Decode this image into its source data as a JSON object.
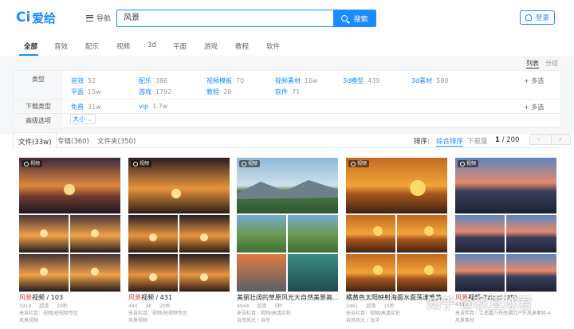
{
  "header": {
    "logo_text": "爱给",
    "nav_label": "导航",
    "search_value": "风景",
    "search_button": "搜索",
    "login_label": "登录"
  },
  "category_tabs": [
    "全部",
    "音效",
    "配乐",
    "视频",
    "3d",
    "平面",
    "游戏",
    "教程",
    "软件"
  ],
  "view_toggle": {
    "list": "列表",
    "group": "分组"
  },
  "filters": {
    "type_label": "类型",
    "type_items": [
      {
        "label": "音效",
        "count": "52"
      },
      {
        "label": "配乐",
        "count": "386"
      },
      {
        "label": "视频模板",
        "count": "70"
      },
      {
        "label": "视频素材",
        "count": "16w"
      },
      {
        "label": "3d模型",
        "count": "439"
      },
      {
        "label": "3d素材",
        "count": "580"
      },
      {
        "label": "平面",
        "count": "15w"
      },
      {
        "label": "游戏",
        "count": "1792"
      },
      {
        "label": "教程",
        "count": "28"
      },
      {
        "label": "软件",
        "count": "71"
      }
    ],
    "more_label": "+ 多选",
    "download_label": "下载类型",
    "download_items": [
      {
        "label": "免费",
        "count": "31w"
      },
      {
        "label": "vip",
        "count": "1.7w"
      }
    ],
    "advanced_label": "高级选项",
    "size_label": "大小"
  },
  "result_tabs": [
    "文件(33w)",
    "专辑(360)",
    "文件夹(350)"
  ],
  "sort": {
    "label": "排序:",
    "options": [
      "综合排序",
      "下载量"
    ],
    "page_current": "1",
    "page_total": "/ 200"
  },
  "cards": [
    {
      "badge": "视频",
      "hl": "风景",
      "title": "视频 / 103",
      "views": "1919",
      "quality": "超清",
      "duration": "20秒",
      "source": "来自栏目：视频/短视频专区",
      "tag": "风景视频"
    },
    {
      "badge": "视频",
      "hl": "风景",
      "title": "视频 / 431",
      "views": "494",
      "quality": "4K",
      "duration": "20秒",
      "source": "来自栏目：视频/短视频专区",
      "tag": "风景视频"
    },
    {
      "badge": "视频",
      "hl": "",
      "title": "美丽壮阔的草原风光大自然美景高...",
      "views": "4944",
      "quality": "超清",
      "duration": "5秒",
      "source": "来自栏目：视频/高清实拍",
      "tag": "自然风光 / 自然"
    },
    {
      "badge": "视频",
      "hl": "",
      "title": "橘黄色太阳映射海面水面荡漾唯美...",
      "views": "2461",
      "quality": "超清",
      "duration": "15秒",
      "source": "来自栏目：视频/高清实拍",
      "tag": "自然风光 / 海洋"
    },
    {
      "badge": "视频",
      "hl": "风景",
      "title": "视频-7zigel (45)",
      "views": "4365",
      "quality": "",
      "duration": "",
      "source": "来自栏目：江南嘉兴舟南湖沉户外风景素材-4",
      "tag": "风景素材"
    }
  ],
  "watermark": "知乎 @秋直球君"
}
